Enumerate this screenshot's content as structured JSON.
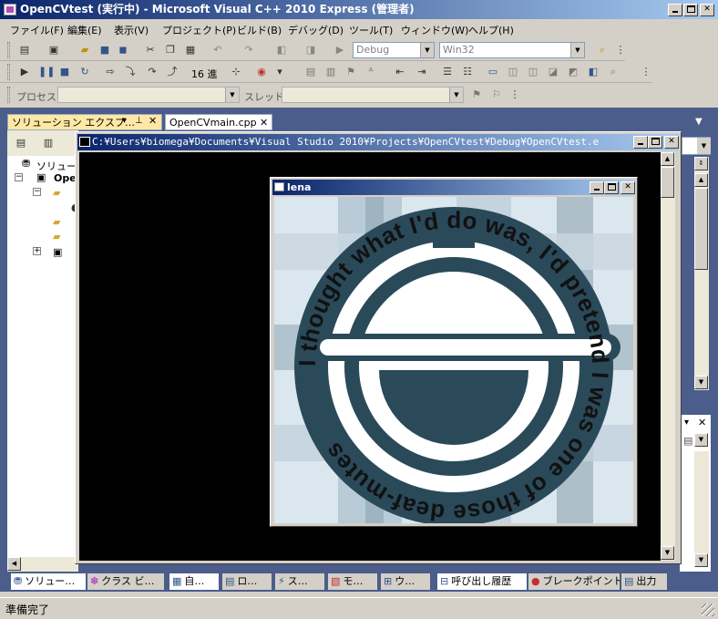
{
  "window": {
    "title": "OpenCVtest (実行中) - Microsoft Visual C++ 2010 Express (管理者)"
  },
  "menu": [
    "ファイル(F)",
    "編集(E)",
    "表示(V)",
    "プロジェクト(P)",
    "ビルド(B)",
    "デバッグ(D)",
    "ツール(T)",
    "ウィンドウ(W)",
    "ヘルプ(H)"
  ],
  "toolbar": {
    "config_combo": "Debug",
    "platform_combo": "Win32",
    "hex_label": "16 進",
    "process_label": "プロセス",
    "thread_label": "スレッド"
  },
  "tabs": {
    "solution_explorer": "ソリューション エクスプ…",
    "pin": "▾ 𝟒 ×",
    "editor_file": "OpenCVmain.cpp"
  },
  "tree": {
    "solution": "ソリューシ",
    "project": "Ope"
  },
  "console": {
    "title": "C:¥Users¥biomega¥Documents¥Visual Studio 2010¥Projects¥OpenCVtest¥Debug¥OpenCVtest.e"
  },
  "image_window": {
    "title": "lena",
    "emblem_ring_text": "I thought what I'd do was, I'd pretend I was one of those deaf-mutes"
  },
  "bottom_tabs": [
    "ソリュー…",
    "クラス ビ…",
    "自…",
    "ロ…",
    "ス…",
    "モ…",
    "ウ…",
    "呼び出し履歴",
    "ブレークポイント",
    "出力"
  ],
  "status": {
    "text": "準備完了"
  },
  "colors": {
    "title_start": "#0a246a",
    "title_end": "#a6caf0",
    "emblem": "#2a4a5a"
  }
}
